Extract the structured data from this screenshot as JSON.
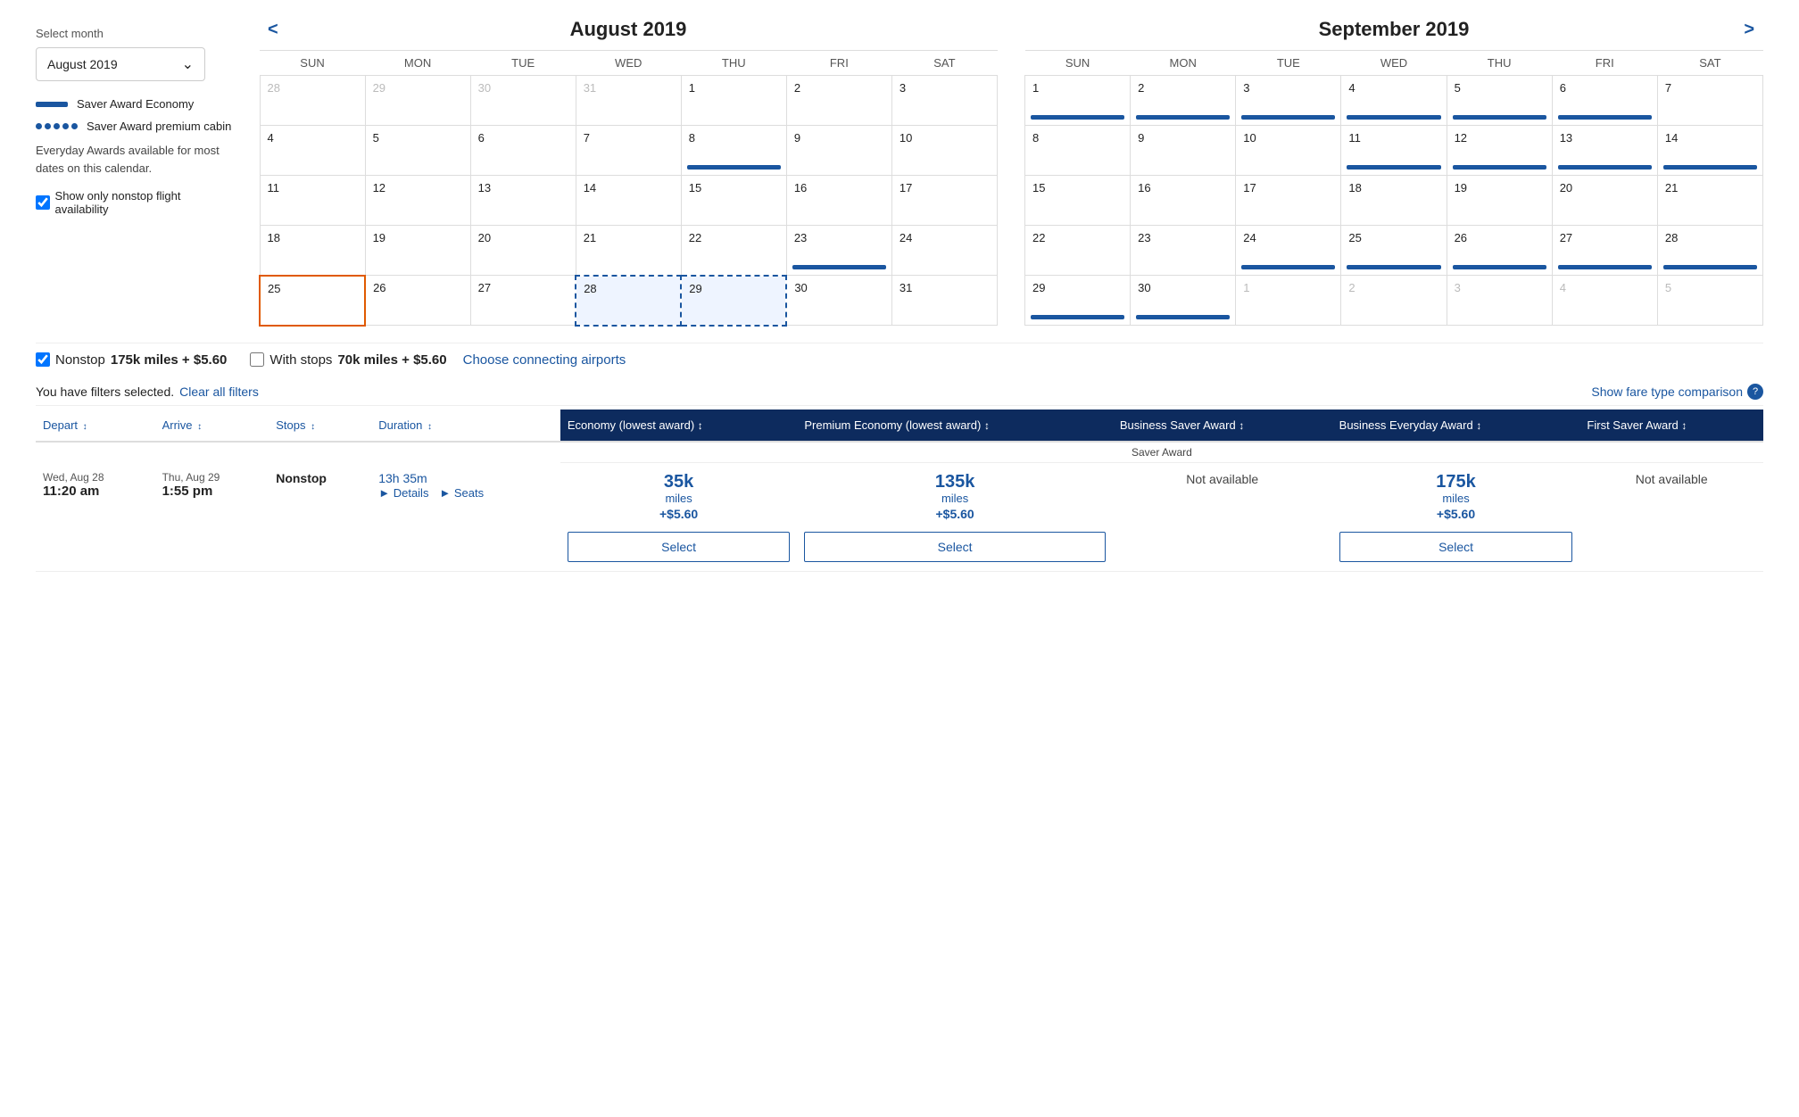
{
  "sidebar": {
    "select_month_label": "Select month",
    "month_value": "August 2019",
    "legend": {
      "saver_economy": "Saver Award Economy",
      "saver_premium": "Saver Award premium cabin",
      "everyday_note": "Everyday Awards available for most dates on this calendar."
    },
    "nonstop_checkbox_label": "Show only nonstop flight availability",
    "nonstop_checked": true
  },
  "calendars": {
    "nav_prev": "<",
    "nav_next": ">",
    "august": {
      "title": "August 2019",
      "days": [
        "SUN",
        "MON",
        "TUE",
        "WED",
        "THU",
        "FRI",
        "SAT"
      ],
      "weeks": [
        [
          {
            "n": "28",
            "om": true
          },
          {
            "n": "29",
            "om": true
          },
          {
            "n": "30",
            "om": true
          },
          {
            "n": "31",
            "om": true
          },
          {
            "n": "1"
          },
          {
            "n": "2"
          },
          {
            "n": "3"
          }
        ],
        [
          {
            "n": "4"
          },
          {
            "n": "5"
          },
          {
            "n": "6"
          },
          {
            "n": "7"
          },
          {
            "n": "8",
            "bar": true
          },
          {
            "n": "9"
          },
          {
            "n": "10"
          }
        ],
        [
          {
            "n": "11"
          },
          {
            "n": "12"
          },
          {
            "n": "13"
          },
          {
            "n": "14"
          },
          {
            "n": "15"
          },
          {
            "n": "16"
          },
          {
            "n": "17"
          }
        ],
        [
          {
            "n": "18"
          },
          {
            "n": "19"
          },
          {
            "n": "20"
          },
          {
            "n": "21"
          },
          {
            "n": "22"
          },
          {
            "n": "23",
            "bar": true
          },
          {
            "n": "24"
          }
        ],
        [
          {
            "n": "25",
            "today": true
          },
          {
            "n": "26"
          },
          {
            "n": "27"
          },
          {
            "n": "28",
            "selected": true
          },
          {
            "n": "29",
            "selected2": true
          },
          {
            "n": "30"
          },
          {
            "n": "31"
          }
        ]
      ]
    },
    "september": {
      "title": "September 2019",
      "days": [
        "SUN",
        "MON",
        "TUE",
        "WED",
        "THU",
        "FRI",
        "SAT"
      ],
      "weeks": [
        [
          {
            "n": "1",
            "bar": true
          },
          {
            "n": "2",
            "bar": true
          },
          {
            "n": "3",
            "bar": true
          },
          {
            "n": "4",
            "bar": true
          },
          {
            "n": "5",
            "bar": true
          },
          {
            "n": "6",
            "bar": true
          },
          {
            "n": "7"
          }
        ],
        [
          {
            "n": "8"
          },
          {
            "n": "9"
          },
          {
            "n": "10"
          },
          {
            "n": "11",
            "bar": true
          },
          {
            "n": "12",
            "bar": true
          },
          {
            "n": "13",
            "bar": true
          },
          {
            "n": "14",
            "bar": true
          }
        ],
        [
          {
            "n": "15"
          },
          {
            "n": "16"
          },
          {
            "n": "17"
          },
          {
            "n": "18"
          },
          {
            "n": "19"
          },
          {
            "n": "20"
          },
          {
            "n": "21"
          }
        ],
        [
          {
            "n": "22"
          },
          {
            "n": "23"
          },
          {
            "n": "24",
            "bar": true
          },
          {
            "n": "25",
            "bar": true
          },
          {
            "n": "26",
            "bar": true
          },
          {
            "n": "27",
            "bar": true
          },
          {
            "n": "28",
            "bar": true
          }
        ],
        [
          {
            "n": "29",
            "bar": true
          },
          {
            "n": "30",
            "bar": true
          },
          {
            "n": "1",
            "om": true
          },
          {
            "n": "2",
            "om": true
          },
          {
            "n": "3",
            "om": true
          },
          {
            "n": "4",
            "om": true
          },
          {
            "n": "5",
            "om": true
          }
        ]
      ]
    }
  },
  "flight_options": {
    "nonstop_label": "Nonstop",
    "nonstop_miles": "175k miles + $5.60",
    "nonstop_checked": true,
    "with_stops_label": "With stops",
    "with_stops_miles": "70k miles + $5.60",
    "with_stops_checked": false,
    "choose_airports_label": "Choose connecting airports"
  },
  "filters": {
    "text": "You have filters selected.",
    "clear_label": "Clear all filters",
    "fare_comparison": "Show fare type comparison"
  },
  "table": {
    "columns": {
      "depart": "Depart",
      "arrive": "Arrive",
      "stops": "Stops",
      "duration": "Duration",
      "economy": "Economy (lowest award)",
      "premium": "Premium Economy (lowest award)",
      "business_saver": "Business Saver Award",
      "business_everyday": "Business Everyday Award",
      "first_saver": "First Saver Award"
    },
    "saver_award_label": "Saver Award",
    "rows": [
      {
        "depart_date": "Wed, Aug 28",
        "depart_time": "11:20 am",
        "arrive_date": "Thu, Aug 29",
        "arrive_time": "1:55 pm",
        "stops": "Nonstop",
        "duration": "13h 35m",
        "economy_miles": "35k",
        "economy_unit": "miles",
        "economy_fee": "+$5.60",
        "premium_miles": "135k",
        "premium_unit": "miles",
        "premium_fee": "+$5.60",
        "business_saver": "Not available",
        "business_everyday_miles": "175k",
        "business_everyday_unit": "miles",
        "business_everyday_fee": "+$5.60",
        "first_saver": "Not available",
        "select_economy": "Select",
        "select_premium": "Select",
        "select_business_everyday": "Select"
      }
    ]
  }
}
